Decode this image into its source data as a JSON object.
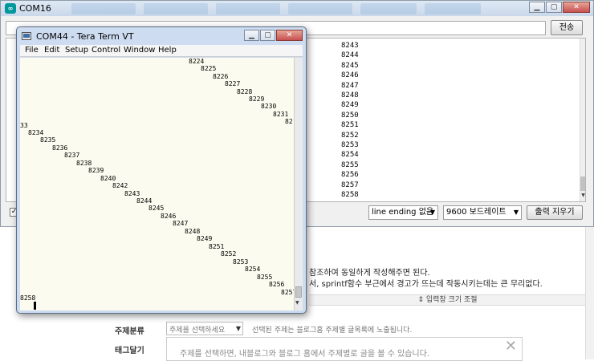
{
  "blog": {
    "line1": "참조하여 동일하게 작성해주면 된다.",
    "line2": "서, sprintf함수 부근에서 경고가 뜨는데 작동시키는데는 큰 무리없다.",
    "resize_label": "⇕ 입력창 크기 조절",
    "category_label": "주제분류",
    "category_placeholder": "주제를 선택하세요",
    "category_hint": "선택된 주제는 블로그홈 주제별 글목록에 노출됩니다.",
    "tag_label": "태그달기",
    "tag_placeholder": "주제를 선택하면, 내블로그와 블로그 홈에서 주제별로 글을 볼 수 있습니다."
  },
  "serial_monitor": {
    "title": "COM16",
    "send_label": "전송",
    "lines": [
      "8243",
      "8244",
      "8245",
      "8246",
      "8247",
      "8248",
      "8249",
      "8250",
      "8251",
      "8252",
      "8253",
      "8254",
      "8255",
      "8256",
      "8257",
      "8258"
    ],
    "autoscroll_mark": "✓",
    "line_ending": "line ending 없음",
    "baud_rate": "9600 보드레이트",
    "clear_label": "출력 지우기"
  },
  "teraterm": {
    "title": "COM44 - Tera Term VT",
    "menu": [
      "File",
      "Edit",
      "Setup",
      "Control",
      "Window",
      "Help"
    ],
    "terminal_lines": [
      {
        "text": "8224"
      },
      {
        "text": "8225"
      },
      {
        "text": "8226"
      },
      {
        "text": "8227"
      },
      {
        "text": "8228"
      },
      {
        "text": "8229"
      },
      {
        "text": "8230"
      },
      {
        "text": "8231"
      },
      {
        "text": "82"
      },
      {
        "text": "33"
      },
      {
        "text": "8234"
      },
      {
        "text": "8235"
      },
      {
        "text": "8236"
      },
      {
        "text": "8237"
      },
      {
        "text": "8238"
      },
      {
        "text": "8239"
      },
      {
        "text": "8240"
      },
      {
        "text": "8242"
      },
      {
        "text": "8243"
      },
      {
        "text": "8244"
      },
      {
        "text": "8245"
      },
      {
        "text": "8246"
      },
      {
        "text": "8247"
      },
      {
        "text": "8248"
      },
      {
        "text": "8249"
      },
      {
        "text": "8251"
      },
      {
        "text": "8252"
      },
      {
        "text": "8253"
      },
      {
        "text": "8254"
      },
      {
        "text": "8255"
      },
      {
        "text": "8256"
      },
      {
        "text": "8257"
      },
      {
        "text": "8258"
      }
    ]
  }
}
